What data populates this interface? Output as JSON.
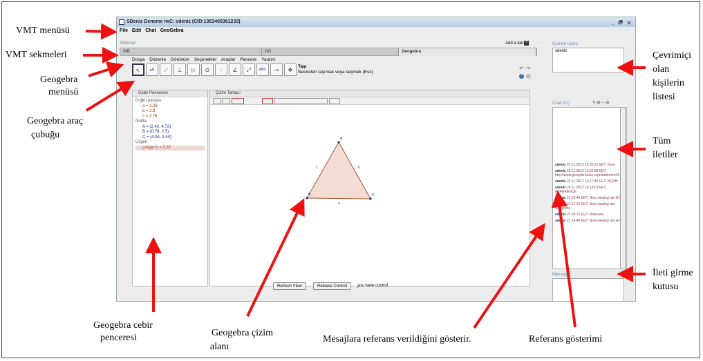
{
  "window": {
    "title": "SDeniz Deneme iwC: sdeniz (CID:1353405361233)",
    "controls": "_ 🗗 ✕",
    "menu": [
      "File",
      "Edit",
      "Chat",
      "GeoGebra"
    ],
    "material_label": "Material:",
    "add_tab_label": "Add a tab",
    "tabs": [
      "WB",
      "GG",
      "Geogebra"
    ]
  },
  "geogebra": {
    "menu": [
      "Dosya",
      "Düzenle",
      "Görünüm",
      "Seçenekler",
      "Araçlar",
      "Pencere",
      "Yardım"
    ],
    "tool_title": "Taşı",
    "tool_hint": "Nesneleri taşımak veya seçmek (Esc)",
    "algebra_title": "Cebir Penceresi",
    "graphics_title": "Çizim Tahtası",
    "algebra_groups": [
      {
        "name": "Doğru parçası",
        "items": [
          "a = 3.26",
          "b = 2.8",
          "c = 2.76"
        ],
        "kind": "seg"
      },
      {
        "name": "Nokta",
        "items": [
          "A = (2.42, 4.72)",
          "B = (0.78, 2.5)",
          "C = (4.04, 2.44)"
        ],
        "kind": "pt"
      },
      {
        "name": "Üçgen",
        "items": [
          "çokgen1 = 3.67"
        ],
        "kind": "poly"
      }
    ],
    "triangle_labels": {
      "A": "A",
      "B": "B",
      "C": "C",
      "a": "a",
      "b": "b",
      "c": "c"
    },
    "buttons": {
      "refresh": "Refresh View",
      "release": "Release Control",
      "status": "you have control"
    }
  },
  "side": {
    "current_users_label": "Current users:",
    "current_user": "sdeniz",
    "chat_label": "Chat (17)",
    "messages": [
      {
        "user": "sdeniz",
        "time": "22.11.2012 15:50:21 EET:",
        "text": "Kare"
      },
      {
        "user": "sdeniz",
        "time": "22.11.2012 15:52:58 EET:",
        "text": "http://www.geogebratube.org/student/m22480"
      },
      {
        "user": "sdeniz",
        "time": "26.11.2012 16:17:46 EET:",
        "text": "HGDH"
      },
      {
        "user": "sdeniz",
        "time": "26.11.2012 16:18:03 EET:",
        "text": "REFERENCE"
      },
      {
        "user": "sdeniz",
        "time": "21:14:46 EET:",
        "text": "Now viewing tab GG"
      },
      {
        "user": "sdeniz",
        "time": "21:17:22 EET:",
        "text": "Now viewing tab Geogebra"
      },
      {
        "user": "sdeniz",
        "time": "21:20:21 EET:",
        "text": "Referans"
      },
      {
        "user": "sdeniz",
        "time": "21:14:48 EET:",
        "text": "Now viewing tab GG"
      }
    ],
    "message_label": "Message:"
  },
  "annotations": {
    "vmt_menu": "VMT menüsü",
    "vmt_tabs": "VMT sekmeleri",
    "gg_menu_1": "Geogebra",
    "gg_menu_2": "menüsü",
    "gg_toolbar_1": "Geogebra araç",
    "gg_toolbar_2": "çubuğu",
    "gg_algebra_1": "Geogebra cebir",
    "gg_algebra_2": "penceresi",
    "gg_draw_1": "Geogebra çizim",
    "gg_draw_2": "alanı",
    "msg_ref": "Mesajlara referans verildiğini gösterir.",
    "ref_show": "Referans gösterimi",
    "online_1": "Çevrimiçi",
    "online_2": "olan",
    "online_3": "kişilerin",
    "online_4": "listesi",
    "all_1": "Tüm",
    "all_2": "iletiler",
    "input_1": "İleti girme",
    "input_2": "kutusu"
  },
  "colors": {
    "arrow": "#ee1111",
    "triangle_fill": "#f2dcd3",
    "triangle_stroke": "#a0522d"
  },
  "icons": [
    "app-icon",
    "move-tool-icon",
    "point-tool-icon",
    "line-tool-icon",
    "perpendicular-tool-icon",
    "polygon-tool-icon",
    "circle-tool-icon",
    "circle-3pts-tool-icon",
    "angle-tool-icon",
    "reflect-tool-icon",
    "text-tool-icon",
    "slider-tool-icon",
    "move-graphics-tool-icon",
    "undo-icon",
    "redo-icon",
    "help-icon",
    "settings-icon",
    "add-tab-icon"
  ]
}
